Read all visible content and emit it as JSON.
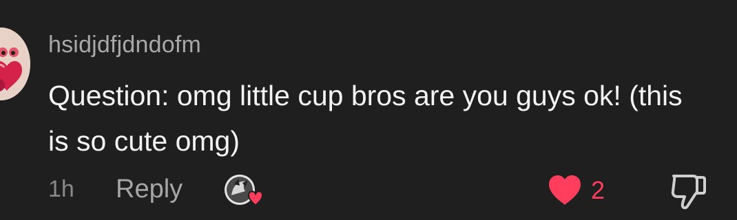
{
  "comment": {
    "username": "hsidjdfjdndofm",
    "text": "Question: omg little cup bros are you guys ok! (this is so cute omg)",
    "time_ago": "1h",
    "reply_label": "Reply",
    "like_count": "2",
    "liked_by_creator": true
  },
  "colors": {
    "background": "#1f1f1f",
    "like_red": "#ff3d5c",
    "username_gray": "#a8a8a8",
    "text_white": "#f4f4f4"
  },
  "icons": {
    "avatar": "user-avatar",
    "creator_like": "creator-liked-heart-icon",
    "like": "heart-icon",
    "dislike": "thumbs-down-icon"
  }
}
